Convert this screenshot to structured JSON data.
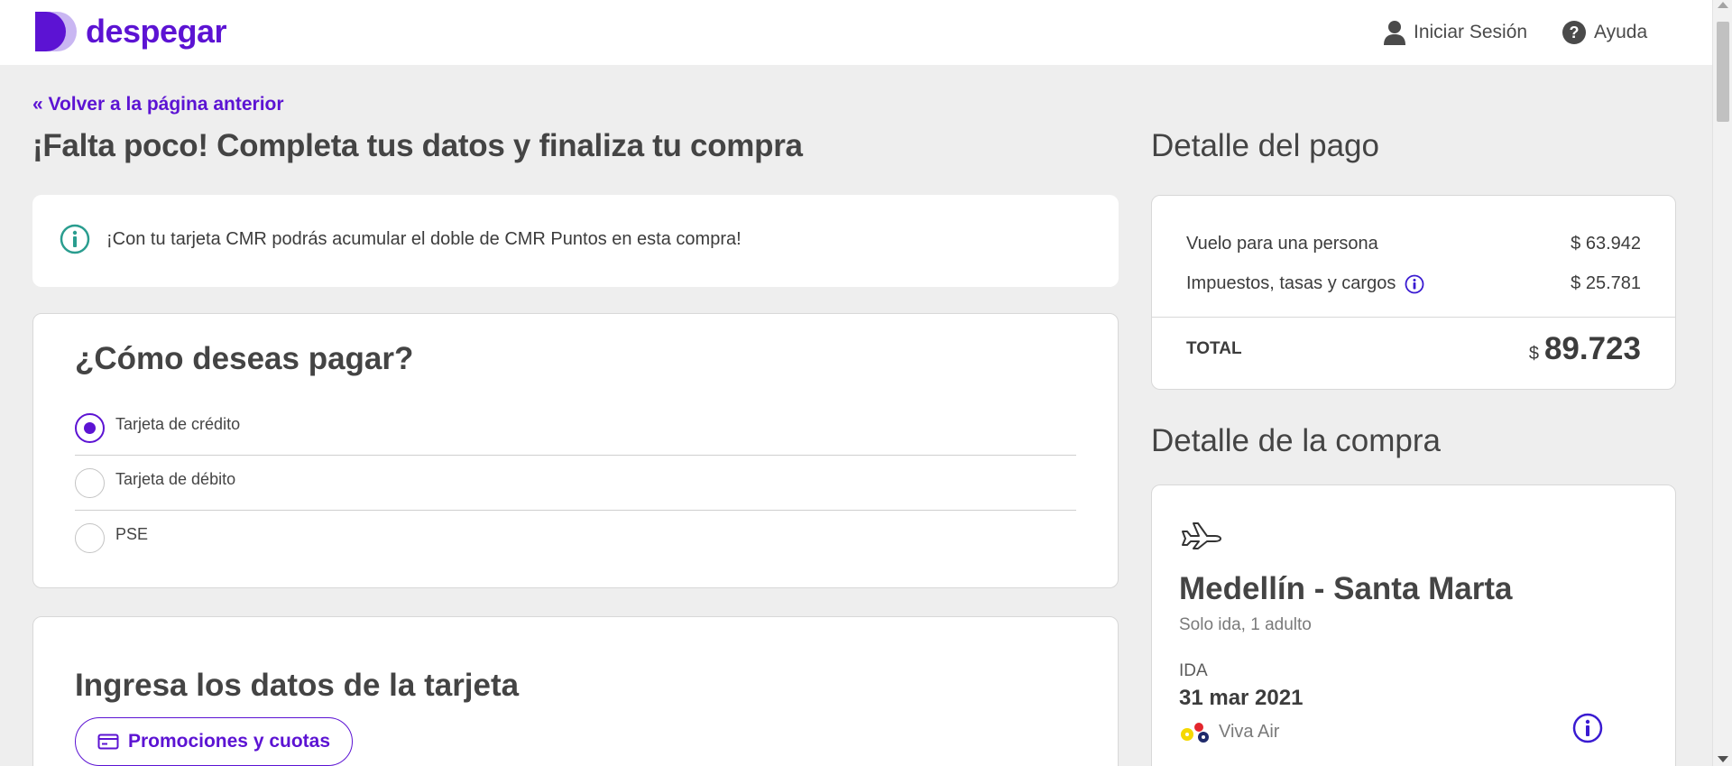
{
  "header": {
    "brand": "despegar",
    "login_label": "Iniciar Sesión",
    "help_label": "Ayuda"
  },
  "main": {
    "back_link": "« Volver a la página anterior",
    "title": "¡Falta poco! Completa tus datos y finaliza tu compra",
    "info_message": "¡Con tu tarjeta CMR podrás acumular el doble de CMR Puntos en esta compra!",
    "payment": {
      "title": "¿Cómo deseas pagar?",
      "options": [
        {
          "label": "Tarjeta de crédito",
          "selected": true
        },
        {
          "label": "Tarjeta de débito",
          "selected": false
        },
        {
          "label": "PSE",
          "selected": false
        }
      ]
    },
    "card_data": {
      "title": "Ingresa los datos de la tarjeta",
      "promo_button": "Promociones y cuotas"
    }
  },
  "sidebar": {
    "payment_detail": {
      "title": "Detalle del pago",
      "rows": [
        {
          "label": "Vuelo para una persona",
          "value": "$ 63.942"
        },
        {
          "label": "Impuestos, tasas y cargos",
          "value": "$ 25.781"
        }
      ],
      "total_label": "TOTAL",
      "total_currency": "$",
      "total_value": "89.723"
    },
    "purchase_detail": {
      "title": "Detalle de la compra",
      "route": "Medellín - Santa Marta",
      "subtitle": "Solo ida, 1 adulto",
      "leg_label": "IDA",
      "date": "31 mar 2021",
      "airline": "Viva Air"
    }
  },
  "colors": {
    "brand": "#5c13d3",
    "info_icon": "#2a9d8f",
    "background": "#eeeeee"
  },
  "icons": {
    "user": "user-icon",
    "help": "help-circle-icon",
    "info": "info-circle-icon",
    "plane": "plane-icon",
    "card": "credit-card-icon"
  }
}
